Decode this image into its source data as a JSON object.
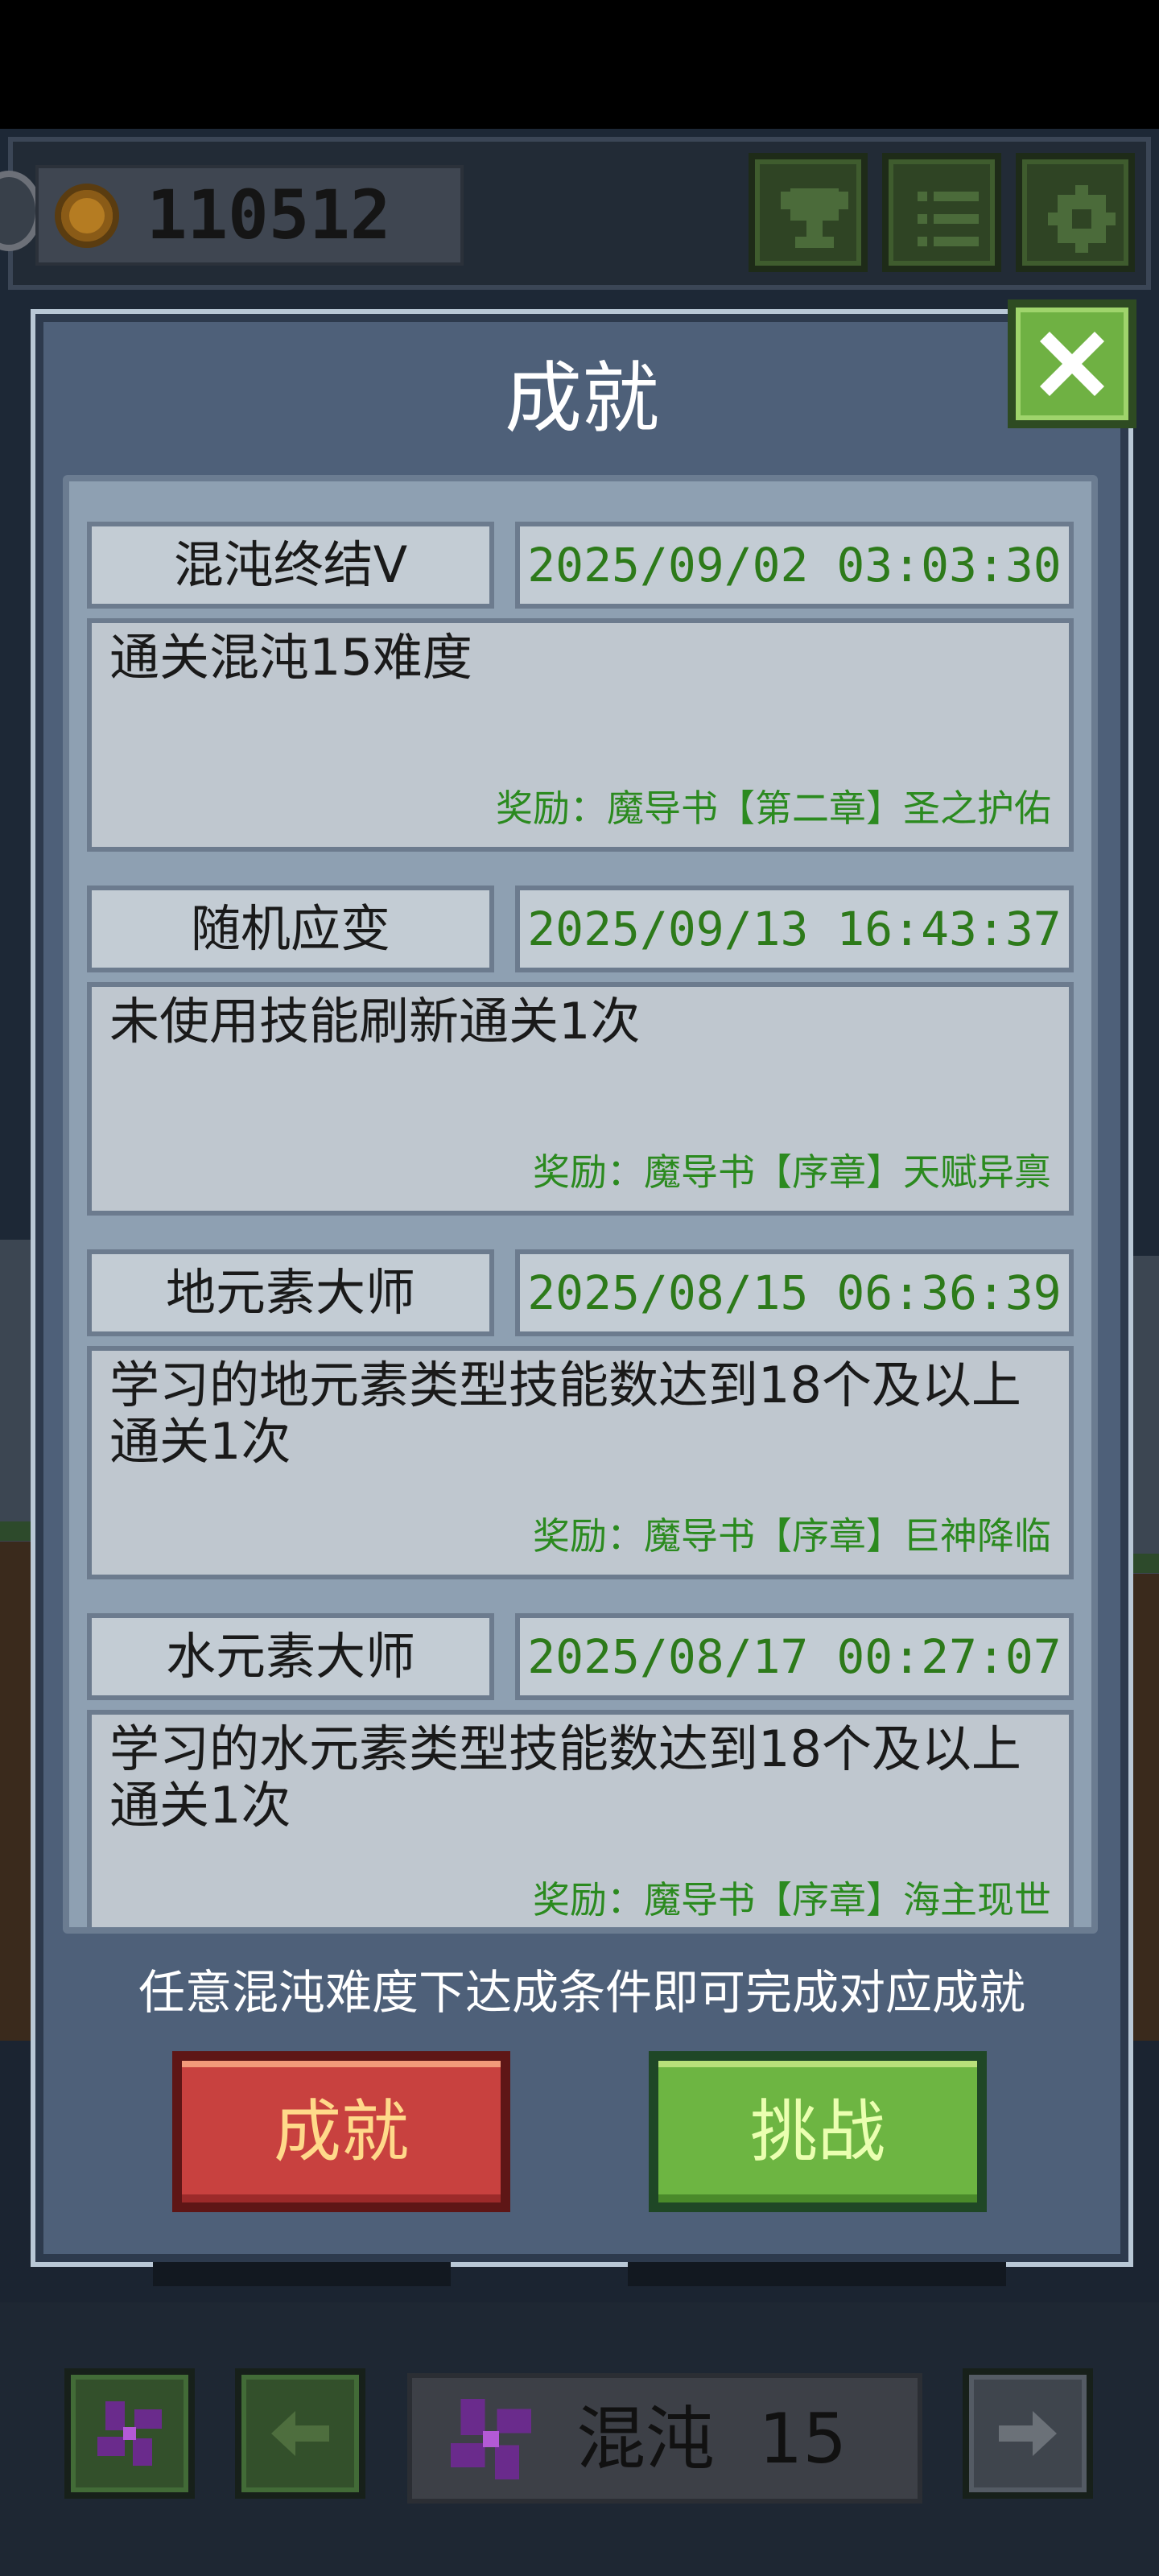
{
  "topbar": {
    "coins": "110512",
    "buttons": [
      "trophy",
      "list",
      "settings"
    ]
  },
  "dialog": {
    "title": "成就",
    "achievements": [
      {
        "name": "混沌终结V",
        "date": "2025/09/02 03:03:30",
        "description": "通关混沌15难度",
        "reward": "奖励：魔导书【第二章】圣之护佑"
      },
      {
        "name": "随机应变",
        "date": "2025/09/13 16:43:37",
        "description": "未使用技能刷新通关1次",
        "reward": "奖励：魔导书【序章】天赋异禀"
      },
      {
        "name": "地元素大师",
        "date": "2025/08/15 06:36:39",
        "description": "学习的地元素类型技能数达到18个及以上通关1次",
        "reward": "奖励：魔导书【序章】巨神降临"
      },
      {
        "name": "水元素大师",
        "date": "2025/08/17 00:27:07",
        "description": "学习的水元素类型技能数达到18个及以上通关1次",
        "reward": "奖励：魔导书【序章】海主现世"
      }
    ],
    "note": "任意混沌难度下达成条件即可完成对应成就",
    "achievement_button": "成就",
    "challenge_button": "挑战"
  },
  "bottom": {
    "mode_label": "混沌  15"
  },
  "colors": {
    "date_text": "#2d7a1a",
    "reward_text": "#2b8a1f",
    "red_button": "#c8413f",
    "green_button": "#6db542"
  }
}
